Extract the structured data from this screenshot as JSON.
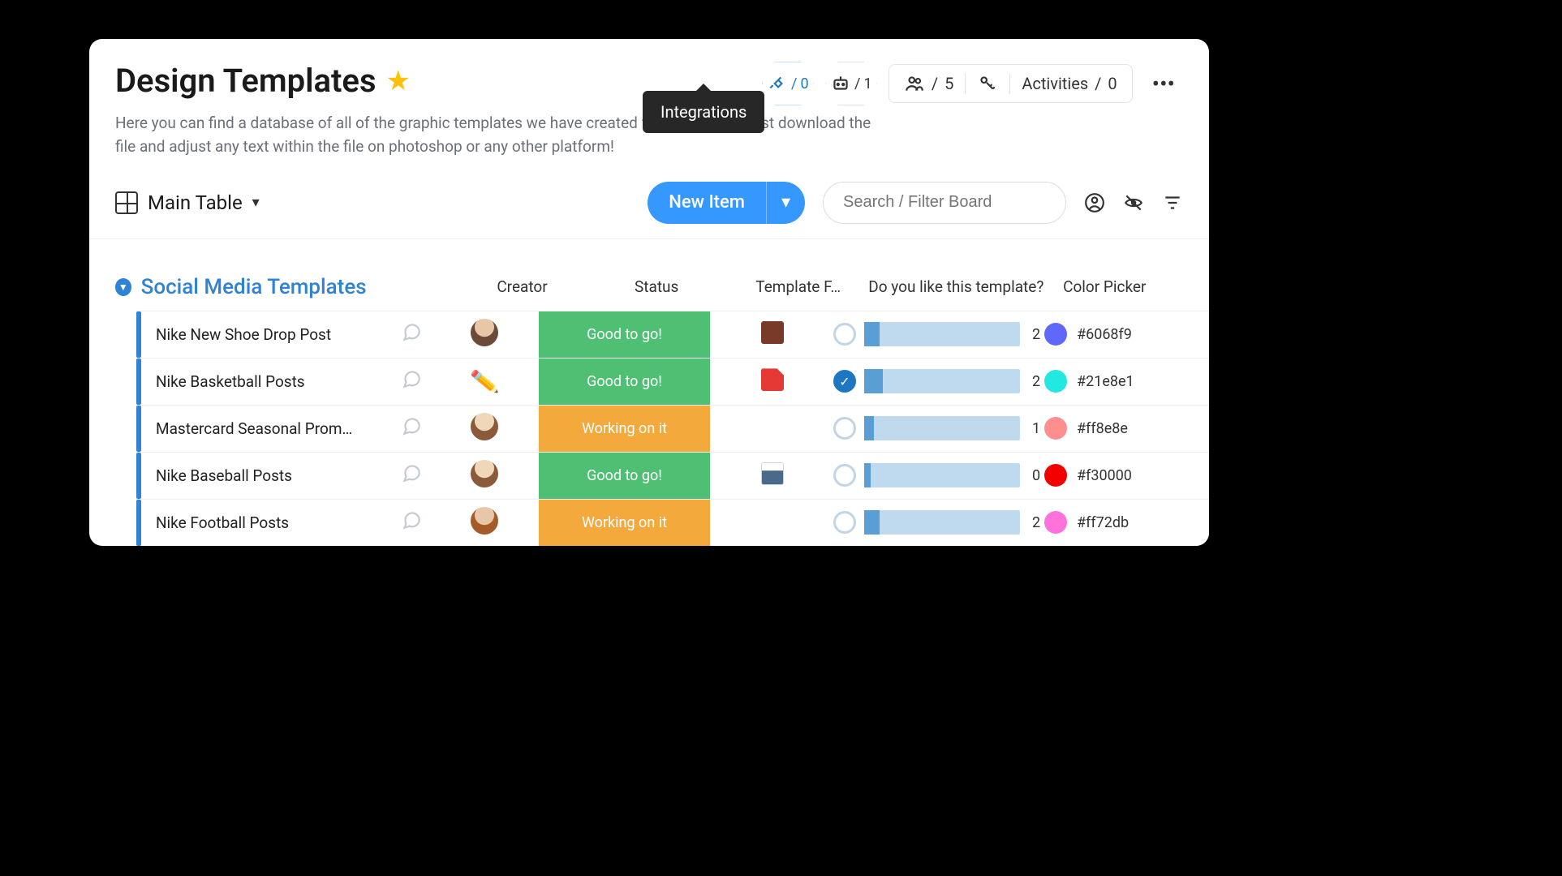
{
  "header": {
    "title": "Design Templates",
    "description": "Here you can find a database of all of the graphic templates we have created for our clients. Just download the file and adjust any text within the file on photoshop or any other platform!",
    "tooltip": "Integrations",
    "integrations_count": "0",
    "automations_count": "1",
    "members_count": "5",
    "activities_label": "Activities",
    "activities_count": "0"
  },
  "toolbar": {
    "view_label": "Main Table",
    "new_item_label": "New Item",
    "search_placeholder": "Search / Filter Board"
  },
  "group": {
    "name": "Social Media Templates",
    "columns": {
      "creator": "Creator",
      "status": "Status",
      "file": "Template F…",
      "vote": "Do you like this template?",
      "color": "Color Picker"
    }
  },
  "rows": [
    {
      "name": "Nike New Shoe Drop Post",
      "creator_type": "avatar",
      "creator_class": "a1",
      "status_label": "Good to go!",
      "status_class": "good",
      "file_class": "file-thumb",
      "file_show": true,
      "vote_checked": false,
      "vote_fill": "10%",
      "vote_count": "2",
      "color_hex": "#6068f9"
    },
    {
      "name": "Nike Basketball Posts",
      "creator_type": "pencil",
      "creator_class": "",
      "status_label": "Good to go!",
      "status_class": "good",
      "file_class": "file-thumb pdf",
      "file_show": true,
      "vote_checked": true,
      "vote_fill": "12%",
      "vote_count": "2",
      "color_hex": "#21e8e1"
    },
    {
      "name": "Mastercard Seasonal Prom…",
      "creator_type": "avatar",
      "creator_class": "a2",
      "status_label": "Working on it",
      "status_class": "working",
      "file_class": "",
      "file_show": false,
      "vote_checked": false,
      "vote_fill": "6%",
      "vote_count": "1",
      "color_hex": "#ff8e8e"
    },
    {
      "name": "Nike Baseball Posts",
      "creator_type": "avatar",
      "creator_class": "a2",
      "status_label": "Good to go!",
      "status_class": "good",
      "file_class": "file-thumb doc",
      "file_show": true,
      "vote_checked": false,
      "vote_fill": "4%",
      "vote_count": "0",
      "color_hex": "#f30000"
    },
    {
      "name": "Nike Football Posts",
      "creator_type": "avatar",
      "creator_class": "a3",
      "status_label": "Working on it",
      "status_class": "working",
      "file_class": "",
      "file_show": false,
      "vote_checked": false,
      "vote_fill": "10%",
      "vote_count": "2",
      "color_hex": "#ff72db"
    }
  ]
}
